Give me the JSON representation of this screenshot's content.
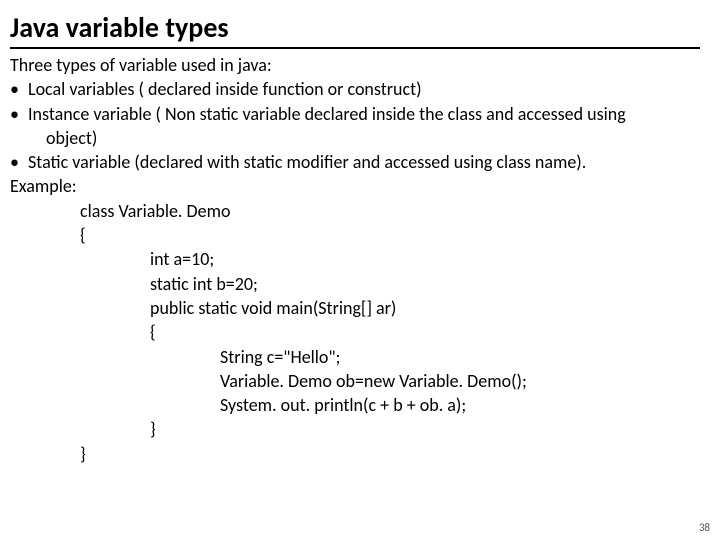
{
  "title": "Java variable types",
  "intro": "Three types of variable used in java:",
  "bullets": [
    {
      "marker": "•",
      "text": "Local variables ( declared inside function or construct)"
    },
    {
      "marker": "•",
      "text": "Instance variable ( Non static variable declared inside the class and accessed using object)",
      "wrap": "object)"
    },
    {
      "marker": "•",
      "text": "Static variable (declared with static modifier and accessed using class name)."
    }
  ],
  "bullet1_line": "Local variables ( declared inside function or construct)",
  "bullet2_line1": "Instance variable ( Non static variable declared inside the class and accessed using",
  "bullet2_line2": "object)",
  "bullet3_line": "Static variable (declared with static modifier and accessed using class name).",
  "example_label": "Example:",
  "code": {
    "l1": "class Variable. Demo",
    "l2": "{",
    "l3": "int a=10;",
    "l4": "static int b=20;",
    "l5": "public static void main(String[] ar)",
    "l6": "{",
    "l7": "String c=\"Hello\";",
    "l8": "Variable. Demo ob=new Variable. Demo();",
    "l9": "System. out. println(c + b  + ob. a);",
    "l10": "}",
    "l11": "}"
  },
  "page_number": "38"
}
